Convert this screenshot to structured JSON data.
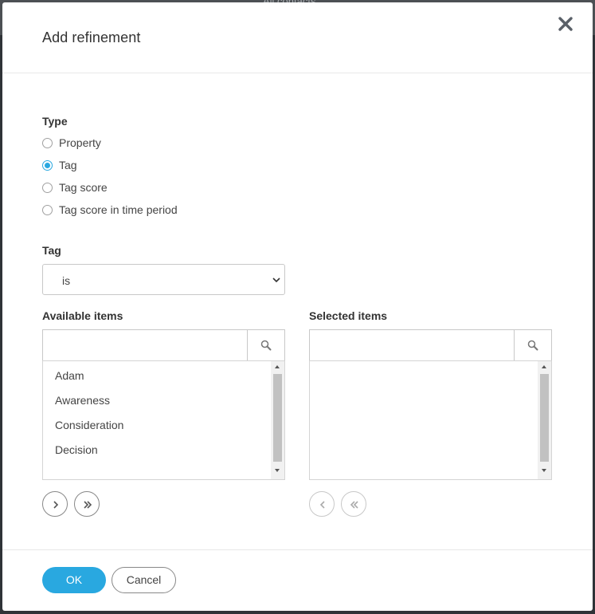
{
  "background": {
    "breadcrumb": "All contacts"
  },
  "dialog": {
    "title": "Add refinement",
    "close_icon": "close-icon"
  },
  "type_section": {
    "label": "Type",
    "options": [
      {
        "label": "Property",
        "checked": false
      },
      {
        "label": "Tag",
        "checked": true
      },
      {
        "label": "Tag score",
        "checked": false
      },
      {
        "label": "Tag score in time period",
        "checked": false
      }
    ]
  },
  "tag_section": {
    "label": "Tag",
    "selected_value": "is"
  },
  "available": {
    "label": "Available items",
    "search_value": "",
    "search_icon": "search-icon",
    "items": [
      "Adam",
      "Awareness",
      "Consideration",
      "Decision"
    ]
  },
  "selected": {
    "label": "Selected items",
    "search_value": "",
    "search_icon": "search-icon",
    "items": []
  },
  "footer": {
    "ok_label": "OK",
    "cancel_label": "Cancel"
  },
  "colors": {
    "accent": "#29a8e0",
    "overlay": "#2f3337"
  }
}
